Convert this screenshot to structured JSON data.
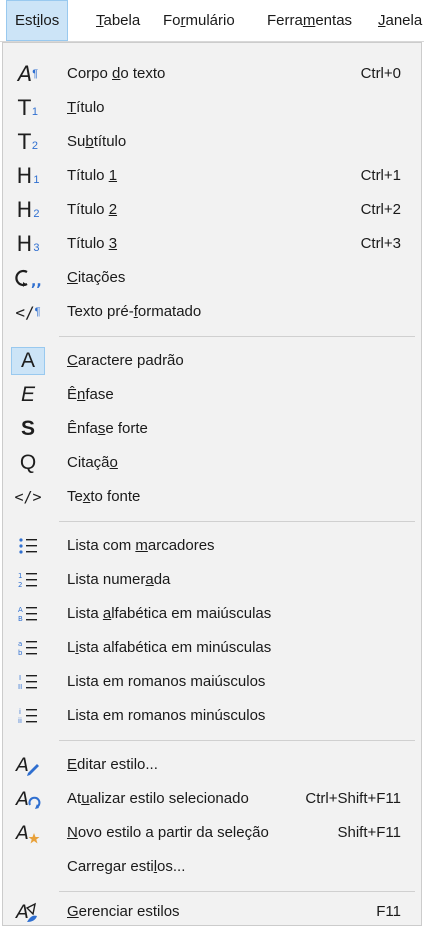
{
  "menubar": {
    "items": [
      {
        "pre": "Est",
        "acc": "i",
        "post": "los"
      },
      {
        "pre": "",
        "acc": "T",
        "post": "abela"
      },
      {
        "pre": "Fo",
        "acc": "r",
        "post": "mulário"
      },
      {
        "pre": "Ferra",
        "acc": "m",
        "post": "entas"
      },
      {
        "pre": "",
        "acc": "J",
        "post": "anela"
      }
    ]
  },
  "menu": {
    "items": [
      {
        "icon": "paragraph-style-icon",
        "pre": "Corpo ",
        "acc": "d",
        "post": "o texto",
        "shortcut": "Ctrl+0"
      },
      {
        "icon": "title-t1-icon",
        "pre": "",
        "acc": "T",
        "post": "ítulo",
        "shortcut": ""
      },
      {
        "icon": "subtitle-t2-icon",
        "pre": "Su",
        "acc": "b",
        "post": "título",
        "shortcut": ""
      },
      {
        "icon": "heading-1-icon",
        "pre": "Título ",
        "acc": "1",
        "post": "",
        "shortcut": "Ctrl+1"
      },
      {
        "icon": "heading-2-icon",
        "pre": "Título ",
        "acc": "2",
        "post": "",
        "shortcut": "Ctrl+2"
      },
      {
        "icon": "heading-3-icon",
        "pre": "Título ",
        "acc": "3",
        "post": "",
        "shortcut": "Ctrl+3"
      },
      {
        "icon": "quotations-icon",
        "pre": "",
        "acc": "C",
        "post": "itações",
        "shortcut": ""
      },
      {
        "icon": "preformatted-text-icon",
        "pre": "Texto pré-",
        "acc": "f",
        "post": "ormatado",
        "shortcut": ""
      },
      {
        "icon": "default-character-icon",
        "pre": "",
        "acc": "C",
        "post": "aractere padrão",
        "shortcut": ""
      },
      {
        "icon": "emphasis-icon",
        "pre": "Ê",
        "acc": "n",
        "post": "fase",
        "shortcut": ""
      },
      {
        "icon": "strong-emphasis-icon",
        "pre": "Ênfa",
        "acc": "s",
        "post": "e forte",
        "shortcut": ""
      },
      {
        "icon": "quotation-char-icon",
        "pre": "Citaçã",
        "acc": "o",
        "post": "",
        "shortcut": ""
      },
      {
        "icon": "source-text-icon",
        "pre": "Te",
        "acc": "x",
        "post": "to fonte",
        "shortcut": ""
      },
      {
        "icon": "bullet-list-icon",
        "pre": "Lista com ",
        "acc": "m",
        "post": "arcadores",
        "shortcut": ""
      },
      {
        "icon": "numbered-list-icon",
        "pre": "Lista numer",
        "acc": "a",
        "post": "da",
        "shortcut": ""
      },
      {
        "icon": "uppercase-alpha-list-icon",
        "pre": "Lista ",
        "acc": "a",
        "post": "lfabética em maiúsculas",
        "shortcut": ""
      },
      {
        "icon": "lowercase-alpha-list-icon",
        "pre": "L",
        "acc": "i",
        "post": "sta alfabética em minúsculas",
        "shortcut": ""
      },
      {
        "icon": "uppercase-roman-list-icon",
        "pre": "Lista em romanos maiúsculos",
        "acc": "",
        "post": "",
        "shortcut": ""
      },
      {
        "icon": "lowercase-roman-list-icon",
        "pre": "Lista em romanos minúsculos",
        "acc": "",
        "post": "",
        "shortcut": ""
      },
      {
        "icon": "edit-style-icon",
        "pre": "",
        "acc": "E",
        "post": "ditar estilo...",
        "shortcut": ""
      },
      {
        "icon": "update-style-icon",
        "pre": "At",
        "acc": "u",
        "post": "alizar estilo selecionado",
        "shortcut": "Ctrl+Shift+F11"
      },
      {
        "icon": "new-style-icon",
        "pre": "",
        "acc": "N",
        "post": "ovo estilo a partir da seleção",
        "shortcut": "Shift+F11"
      },
      {
        "icon": "",
        "pre": "Carregar esti",
        "acc": "l",
        "post": "os...",
        "shortcut": ""
      },
      {
        "icon": "manage-styles-icon",
        "pre": "",
        "acc": "G",
        "post": "erenciar estilos",
        "shortcut": "F11"
      }
    ]
  },
  "icon_glyphs": {
    "t": "T",
    "h": "H",
    "n1": "1",
    "n2": "2",
    "n3": "3",
    "a": "A",
    "e": "E",
    "s": "S",
    "q": "Q",
    "pilcrow": "¶",
    "code": "</>",
    "code_open": "</"
  },
  "colors": {
    "menu_bg": "#f2f2f2",
    "highlight_bg": "#cce4f7",
    "highlight_border": "#99c9ef",
    "icon_accent": "#2f6fd0",
    "icon_orange": "#e8a13a"
  }
}
